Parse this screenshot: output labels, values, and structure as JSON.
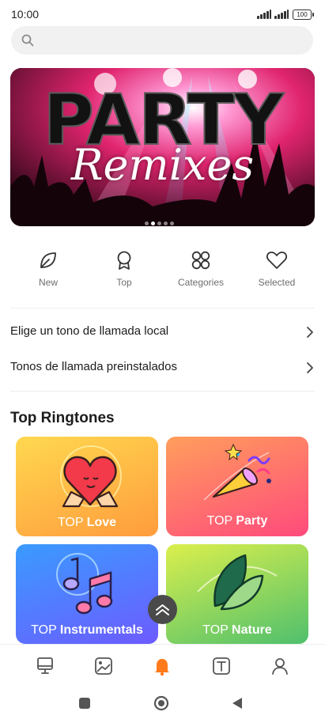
{
  "status": {
    "time": "10:00",
    "battery": "100"
  },
  "search": {
    "placeholder": ""
  },
  "banner": {
    "word1": "PARTY",
    "word2": "Remixes",
    "slides": 5,
    "active_slide": 2
  },
  "quick_actions": [
    {
      "label": "New",
      "icon": "leaf-icon"
    },
    {
      "label": "Top",
      "icon": "award-ribbon-icon"
    },
    {
      "label": "Categories",
      "icon": "grid-categories-icon"
    },
    {
      "label": "Selected",
      "icon": "heart-icon"
    }
  ],
  "links": [
    {
      "label": "Elige un tono de llamada local"
    },
    {
      "label": "Tonos de llamada preinstalados"
    }
  ],
  "top_section": {
    "title": "Top Ringtones",
    "cards": [
      {
        "prefix": "TOP",
        "name": "Love",
        "gradient": [
          "#ffd34d",
          "#ff9a3c"
        ]
      },
      {
        "prefix": "TOP",
        "name": "Party",
        "gradient": [
          "#ff9a5a",
          "#ff4f7a"
        ]
      },
      {
        "prefix": "TOP",
        "name": "Instrumentals",
        "gradient": [
          "#3d9cff",
          "#6a5cff"
        ]
      },
      {
        "prefix": "TOP",
        "name": "Nature",
        "gradient": [
          "#d8ef4c",
          "#54c26a"
        ]
      }
    ]
  },
  "bottom_nav": [
    {
      "icon": "wallpaper-icon",
      "active": false
    },
    {
      "icon": "image-icon",
      "active": false
    },
    {
      "icon": "bell-icon",
      "active": true
    },
    {
      "icon": "text-icon",
      "active": false
    },
    {
      "icon": "profile-icon",
      "active": false
    }
  ],
  "colors": {
    "accent": "#ff7a1a",
    "icon_gray": "#555555"
  }
}
